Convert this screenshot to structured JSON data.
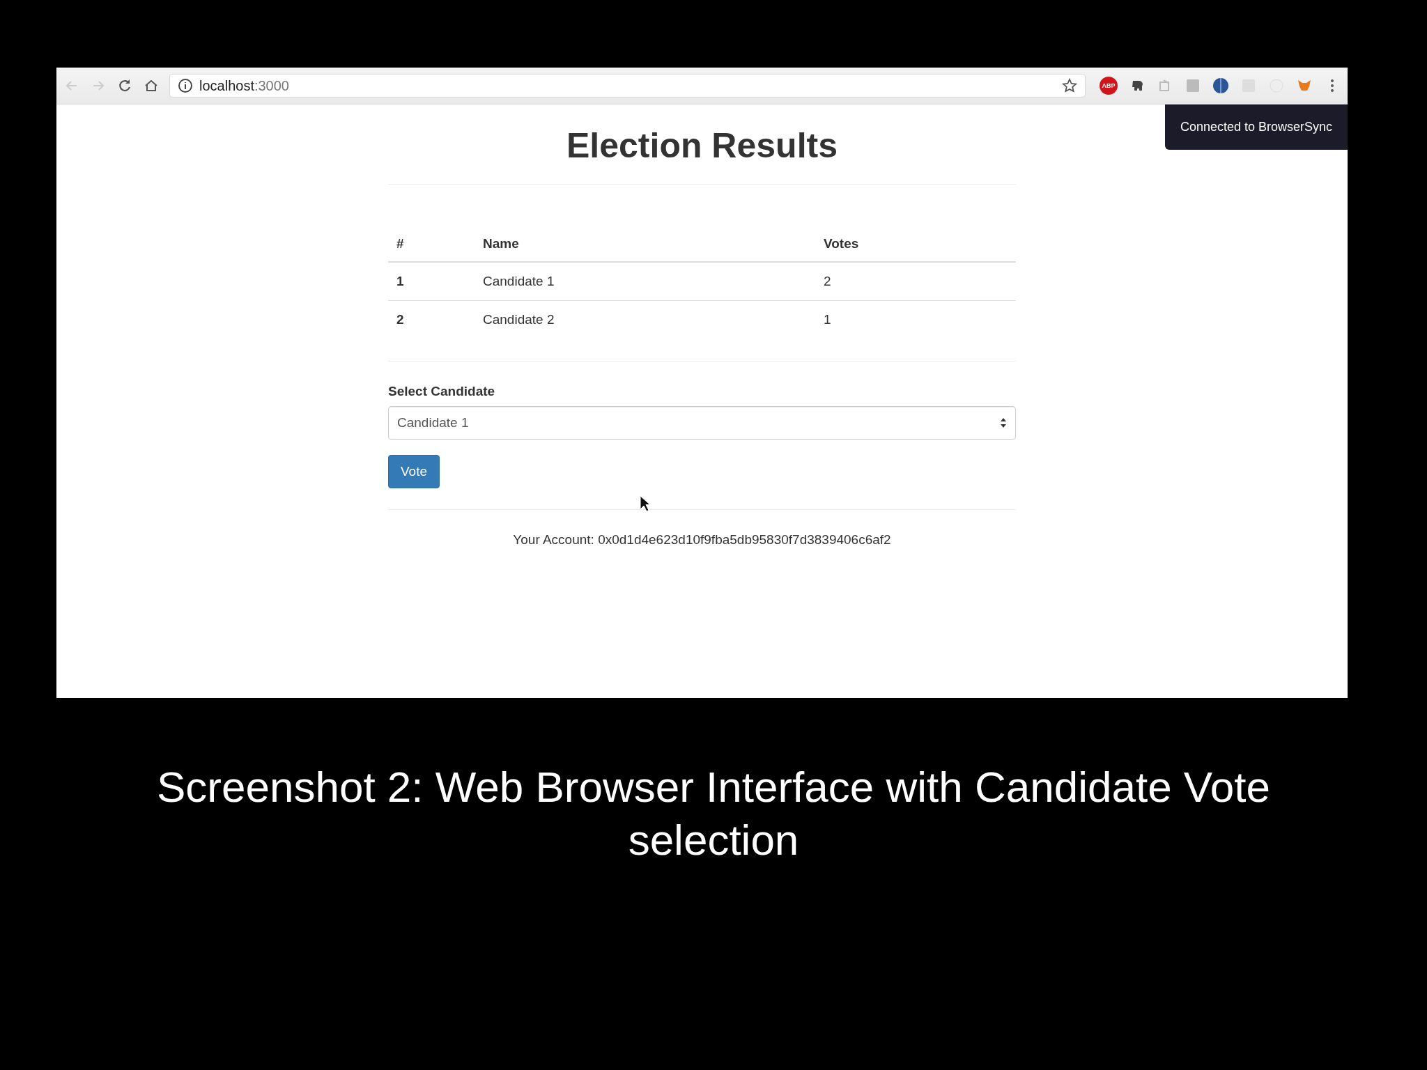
{
  "browser": {
    "address": {
      "host": "localhost",
      "port": ":3000"
    },
    "abp_label": "ABP"
  },
  "toast": "Connected to BrowserSync",
  "page": {
    "title": "Election Results",
    "table": {
      "columns": [
        "#",
        "Name",
        "Votes"
      ],
      "rows": [
        {
          "cells": [
            "1",
            "Candidate 1",
            "2"
          ]
        },
        {
          "cells": [
            "2",
            "Candidate 2",
            "1"
          ]
        }
      ]
    },
    "select": {
      "label": "Select Candidate",
      "value": "Candidate 1"
    },
    "vote_button": "Vote",
    "account": "Your Account: 0x0d1d4e623d10f9fba5db95830f7d3839406c6af2"
  },
  "caption": "Screenshot 2: Web Browser Interface with Candidate Vote selection"
}
